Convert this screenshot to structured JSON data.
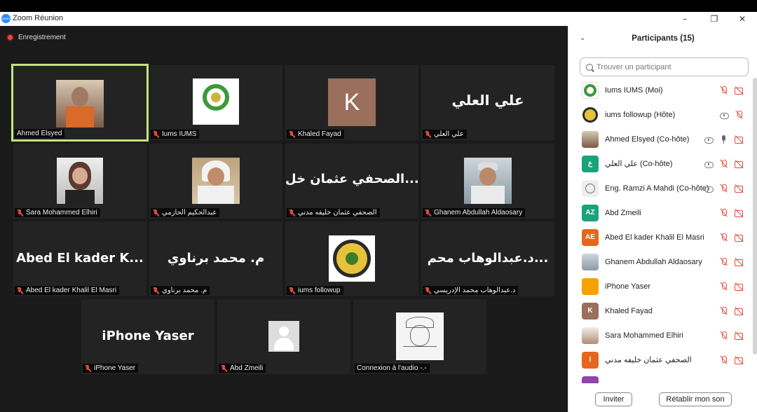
{
  "window": {
    "title": "Zoom Réunion",
    "logo_text": "zoom"
  },
  "recording": {
    "label": "Enregistrement"
  },
  "panel": {
    "title": "Participants (15)",
    "search_placeholder": "Trouver un participant",
    "invite_label": "Inviter",
    "unmute_label": "Rétablir mon son"
  },
  "tiles": [
    {
      "name": "Ahmed Elsyed",
      "big_text": "",
      "muted": false
    },
    {
      "name": "Iums IUMS",
      "big_text": "",
      "muted": true
    },
    {
      "name": "Khaled Fayad",
      "big_text": "",
      "muted": true,
      "avatar_letter": "K"
    },
    {
      "name": "علي العلي",
      "big_text": "علي العلي",
      "muted": true
    },
    {
      "name": "Sara Mohammed Elhiri",
      "big_text": "",
      "muted": true
    },
    {
      "name": "عبدالحكيم الحازمي",
      "big_text": "",
      "muted": true
    },
    {
      "name": "الصحفي عثمان خليفه مدني",
      "big_text": "الصحفي عثمان خل...",
      "muted": true
    },
    {
      "name": "Ghanem Abdullah Aldaosary",
      "big_text": "",
      "muted": true
    },
    {
      "name": "Abed El kader Khalil El Masri",
      "big_text": "Abed El kader K...",
      "muted": true
    },
    {
      "name": "م. محمد برناوي",
      "big_text": "م. محمد برناوي",
      "muted": true
    },
    {
      "name": "iums followup",
      "big_text": "",
      "muted": true
    },
    {
      "name": "د.عبدالوهاب محمد الإدريسي",
      "big_text": "د.عبدالوهاب محم...",
      "muted": true
    },
    {
      "name": "iPhone Yaser",
      "big_text": "iPhone Yaser",
      "muted": true
    },
    {
      "name": "Abd Zmeili",
      "big_text": "",
      "muted": true
    },
    {
      "name": "Connexion à l'audio -.-",
      "big_text": "",
      "muted": false
    }
  ],
  "participants": [
    {
      "name": "Iums IUMS (Moi)",
      "avatar": "",
      "color": "#ffffff"
    },
    {
      "name": "iums followup (Hôte)",
      "avatar": "",
      "color": "#ffffff"
    },
    {
      "name": "Ahmed Elsyed (Co-hôte)",
      "avatar": "",
      "color": "#cccccc"
    },
    {
      "name": "علي العلي (Co-hôte)",
      "avatar": "ع",
      "color": "#1aa37a"
    },
    {
      "name": "Eng. Ramzi A Mahdi (Co-hôte)",
      "avatar": "",
      "color": "#dddddd"
    },
    {
      "name": "Abd Zmeili",
      "avatar": "AZ",
      "color": "#1aa37a"
    },
    {
      "name": "Abed El kader Khalil El Masri",
      "avatar": "AE",
      "color": "#e5661d"
    },
    {
      "name": "Ghanem Abdullah Aldaosary",
      "avatar": "",
      "color": "#bbbbbb"
    },
    {
      "name": "iPhone Yaser",
      "avatar": "",
      "color": "#f5a100"
    },
    {
      "name": "Khaled Fayad",
      "avatar": "K",
      "color": "#9a6f5c"
    },
    {
      "name": "Sara Mohammed Elhiri",
      "avatar": "",
      "color": "#c9a48a"
    },
    {
      "name": "الصحفي عثمان خليفه مدني",
      "avatar": "I",
      "color": "#e5661d"
    }
  ]
}
